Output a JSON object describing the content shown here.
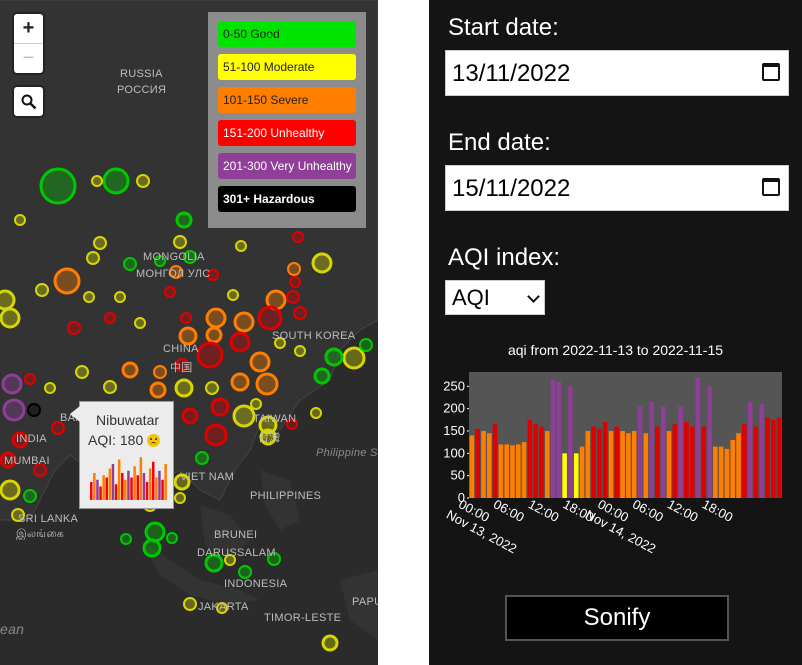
{
  "map": {
    "zoom_in": "+",
    "zoom_out": "−",
    "legend": [
      {
        "label": "0-50 Good",
        "color": "#00e400",
        "text": "#222222",
        "bold": false
      },
      {
        "label": "51-100 Moderate",
        "color": "#ffff00",
        "text": "#222222",
        "bold": false
      },
      {
        "label": "101-150 Severe",
        "color": "#ff7e00",
        "text": "#222222",
        "bold": false
      },
      {
        "label": "151-200 Unhealthy",
        "color": "#ff0000",
        "text": "#ffffff",
        "bold": false
      },
      {
        "label": "201-300 Very Unhealthy",
        "color": "#8f3f97",
        "text": "#ffffff",
        "bold": false
      },
      {
        "label": "301+ Hazardous",
        "color": "#000000",
        "text": "#ffffff",
        "bold": true
      }
    ],
    "labels": [
      {
        "text": "RUSSIA",
        "kind": "country"
      },
      {
        "text": "РОССИЯ",
        "kind": "country"
      },
      {
        "text": "MONGOLIA",
        "kind": "country"
      },
      {
        "text": "МОНГОЛ УЛС",
        "kind": "country"
      },
      {
        "text": "SOUTH KOREA",
        "kind": "country"
      },
      {
        "text": "CHINA",
        "kind": "country"
      },
      {
        "text": "中国",
        "kind": "country"
      },
      {
        "text": "TAIWAN",
        "kind": "country"
      },
      {
        "text": "台灣",
        "kind": "country"
      },
      {
        "text": "INDIA",
        "kind": "country"
      },
      {
        "text": "MUMBAI",
        "kind": "city"
      },
      {
        "text": "BAN",
        "kind": "country"
      },
      {
        "text": "VIET NAM",
        "kind": "country"
      },
      {
        "text": "PHILIPPINES",
        "kind": "country"
      },
      {
        "text": "Philippine Se",
        "kind": "water"
      },
      {
        "text": "SRI LANKA",
        "kind": "country"
      },
      {
        "text": "இலங்கை",
        "kind": "country"
      },
      {
        "text": "BRUNEI",
        "kind": "country"
      },
      {
        "text": "DARUSSALAM",
        "kind": "country"
      },
      {
        "text": "INDONESIA",
        "kind": "country"
      },
      {
        "text": "JAKARTA",
        "kind": "city"
      },
      {
        "text": "TIMOR-LESTE",
        "kind": "country"
      },
      {
        "text": "PAPU",
        "kind": "country"
      },
      {
        "text": "ean",
        "kind": "water"
      }
    ],
    "popup": {
      "title": "Nibuwatar",
      "aqi_label": "AQI: 180"
    }
  },
  "panel": {
    "start_label": "Start date:",
    "start_value": "13/11/2022",
    "end_label": "End date:",
    "end_value": "15/11/2022",
    "index_label": "AQI index:",
    "index_selected": "AQI",
    "button": "Sonify"
  },
  "chart_data": {
    "type": "bar",
    "title": "aqi from 2022-11-13 to 2022-11-15",
    "y_ticks": [
      0,
      50,
      100,
      150,
      200,
      250
    ],
    "ylim": [
      0,
      282
    ],
    "x_ticks": [
      "00:00\nNov 13, 2022",
      "06:00",
      "12:00",
      "18:00",
      "00:00\nNov 14, 2022",
      "06:00",
      "12:00",
      "18:00"
    ],
    "background": "#555555",
    "values": [
      140,
      155,
      150,
      145,
      165,
      120,
      120,
      118,
      120,
      125,
      175,
      165,
      160,
      150,
      265,
      260,
      100,
      250,
      100,
      115,
      150,
      160,
      155,
      170,
      150,
      160,
      150,
      145,
      150,
      205,
      145,
      215,
      160,
      205,
      150,
      165,
      205,
      170,
      160,
      270,
      160,
      250,
      115,
      115,
      110,
      130,
      145,
      165,
      215,
      160,
      210,
      180,
      175,
      180
    ]
  }
}
